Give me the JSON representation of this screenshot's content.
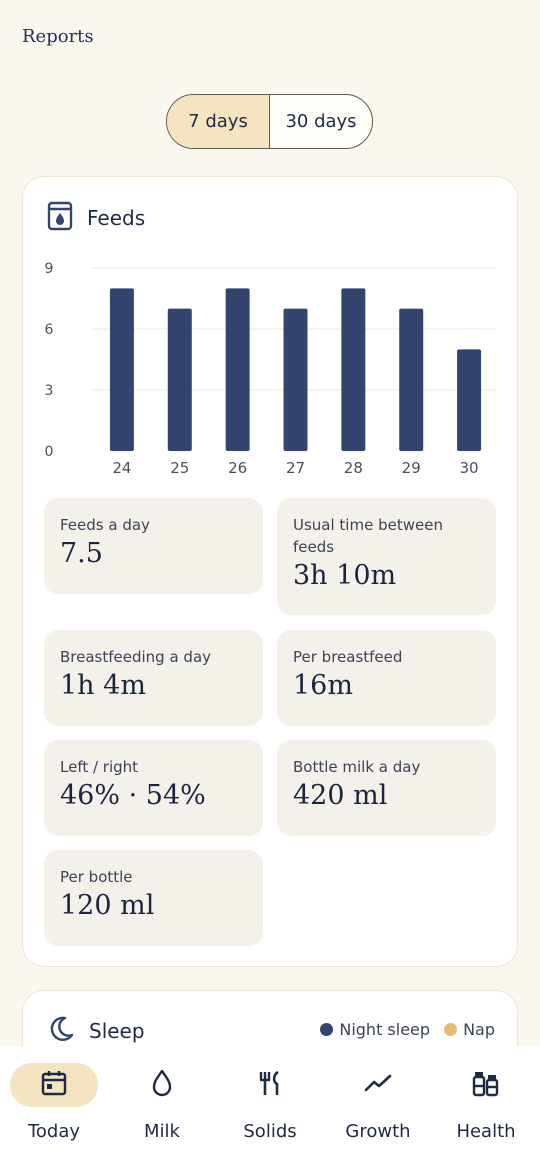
{
  "header": {
    "title": "Reports"
  },
  "range_toggle": {
    "options": [
      "7 days",
      "30 days"
    ],
    "selected": "7 days"
  },
  "feeds_card": {
    "title": "Feeds",
    "icon": "bottle-icon",
    "stats": [
      {
        "label": "Feeds a day",
        "value": "7.5"
      },
      {
        "label": "Usual time between feeds",
        "value": "3h 10m"
      },
      {
        "label": "Breastfeeding a day",
        "value": "1h 4m"
      },
      {
        "label": "Per breastfeed",
        "value": "16m"
      },
      {
        "label": "Left / right",
        "value": "46% · 54%"
      },
      {
        "label": "Bottle milk a day",
        "value": "420 ml"
      },
      {
        "label": "Per bottle",
        "value": "120 ml"
      }
    ]
  },
  "chart_data": {
    "type": "bar",
    "categories": [
      "24",
      "25",
      "26",
      "27",
      "28",
      "29",
      "30"
    ],
    "values": [
      8,
      7,
      8,
      7,
      8,
      7,
      5
    ],
    "yticks": [
      "0",
      "3",
      "6",
      "9"
    ],
    "ylim": [
      0,
      9
    ],
    "grid": true,
    "bar_color": "#33456e"
  },
  "sleep_card": {
    "title": "Sleep",
    "icon": "moon-icon",
    "legend": [
      {
        "label": "Night sleep",
        "color": "#33456e"
      },
      {
        "label": "Nap",
        "color": "#e8b877"
      }
    ]
  },
  "bottom_nav": {
    "items": [
      {
        "label": "Today",
        "icon": "calendar-icon",
        "active": true
      },
      {
        "label": "Milk",
        "icon": "drop-icon",
        "active": false
      },
      {
        "label": "Solids",
        "icon": "utensils-icon",
        "active": false
      },
      {
        "label": "Growth",
        "icon": "trend-icon",
        "active": false
      },
      {
        "label": "Health",
        "icon": "medicine-icon",
        "active": false
      }
    ]
  },
  "colors": {
    "background": "#faf7ef",
    "accent": "#f4e4c0",
    "navy": "#33456e"
  }
}
